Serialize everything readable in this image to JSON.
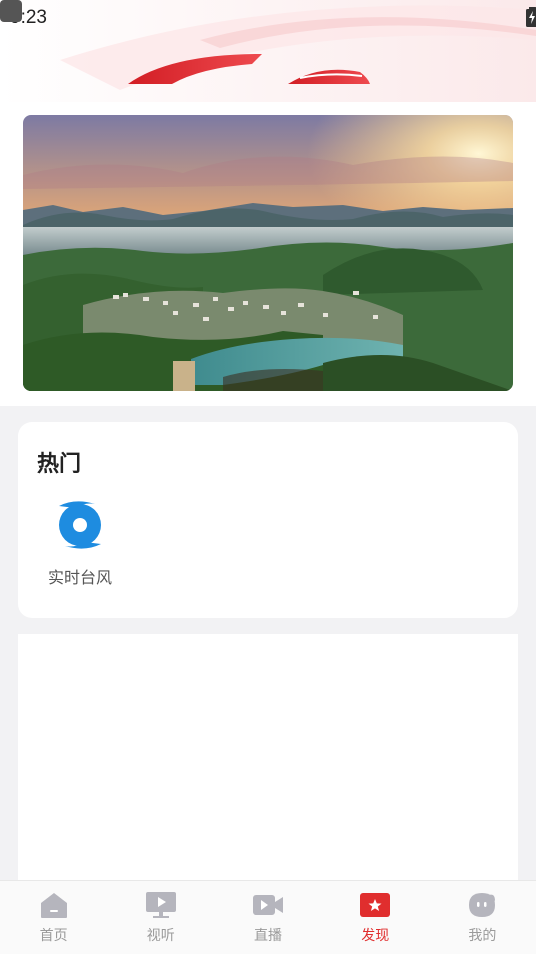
{
  "status_bar": {
    "time": "9:23",
    "icons_left": [
      "a-icon",
      "download-icon",
      "app-square-icon"
    ],
    "icons_right": [
      "wifi-icon",
      "signal-icon",
      "battery-icon"
    ]
  },
  "banner": {
    "image": "mountain-village-lake-photo"
  },
  "hot_section": {
    "title": "热门",
    "items": [
      {
        "label": "实时台风",
        "icon": "typhoon-icon",
        "color": "#1e8ce0"
      }
    ]
  },
  "tab_bar": {
    "tabs": [
      {
        "label": "首页",
        "icon": "home-icon",
        "active": false
      },
      {
        "label": "视听",
        "icon": "video-icon",
        "active": false
      },
      {
        "label": "直播",
        "icon": "live-camera-icon",
        "active": false
      },
      {
        "label": "发现",
        "icon": "discover-star-icon",
        "active": true
      },
      {
        "label": "我的",
        "icon": "profile-icon",
        "active": false
      }
    ]
  },
  "colors": {
    "accent": "#e02e2e",
    "tab_inactive": "#b5b5bd",
    "typhoon": "#1e8ce0"
  }
}
